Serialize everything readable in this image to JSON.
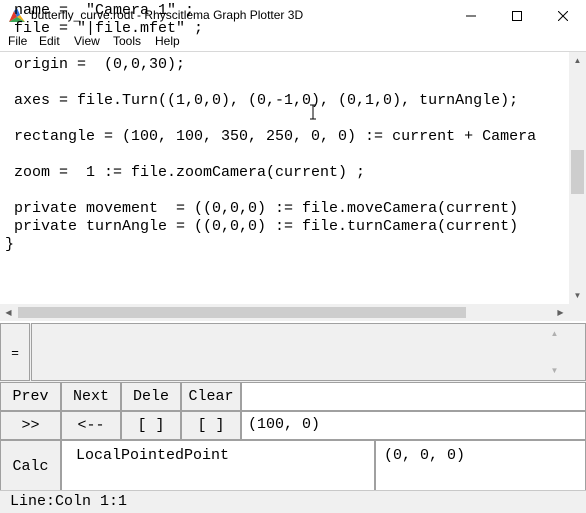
{
  "window": {
    "title": "butterfly_curve.rodt - Rhyscitlema Graph Plotter 3D",
    "controls": [
      "minimize",
      "maximize",
      "close"
    ]
  },
  "menu": [
    "File",
    "Edit",
    "View",
    "Tools",
    "Help"
  ],
  "editor": {
    "lines": [
      " name =  \"Camera 1\" ;",
      " file = \"|file.mfet\" ;",
      "",
      " origin =  (0,0,30);",
      "",
      " axes = file.Turn((1,0,0), (0,-1,0), (0,1,0), turnAngle);",
      "",
      " rectangle = (100, 100, 350, 250, 0, 0) := current + Camera",
      "",
      " zoom =  1 := file.zoomCamera(current) ;",
      "",
      " private movement  = ((0,0,0) := file.moveCamera(current)",
      " private turnAngle = ((0,0,0) := file.turnCamera(current)",
      "}"
    ]
  },
  "command": {
    "eq_label": "=",
    "value": ""
  },
  "buttons": {
    "prev": "Prev",
    "next": "Next",
    "dele": "Dele",
    "clear": "Clear",
    "forward": ">>",
    "back": "<--",
    "brackets_empty": "[ ]",
    "brackets_open": "[  ]",
    "calc": "Calc"
  },
  "fields": {
    "top_value": "",
    "point_value": "(100, 0)",
    "calc_expression": "LocalPointedPoint",
    "calc_result": "(0, 0, 0)"
  },
  "status": {
    "text": "Line:Coln 1:1"
  }
}
